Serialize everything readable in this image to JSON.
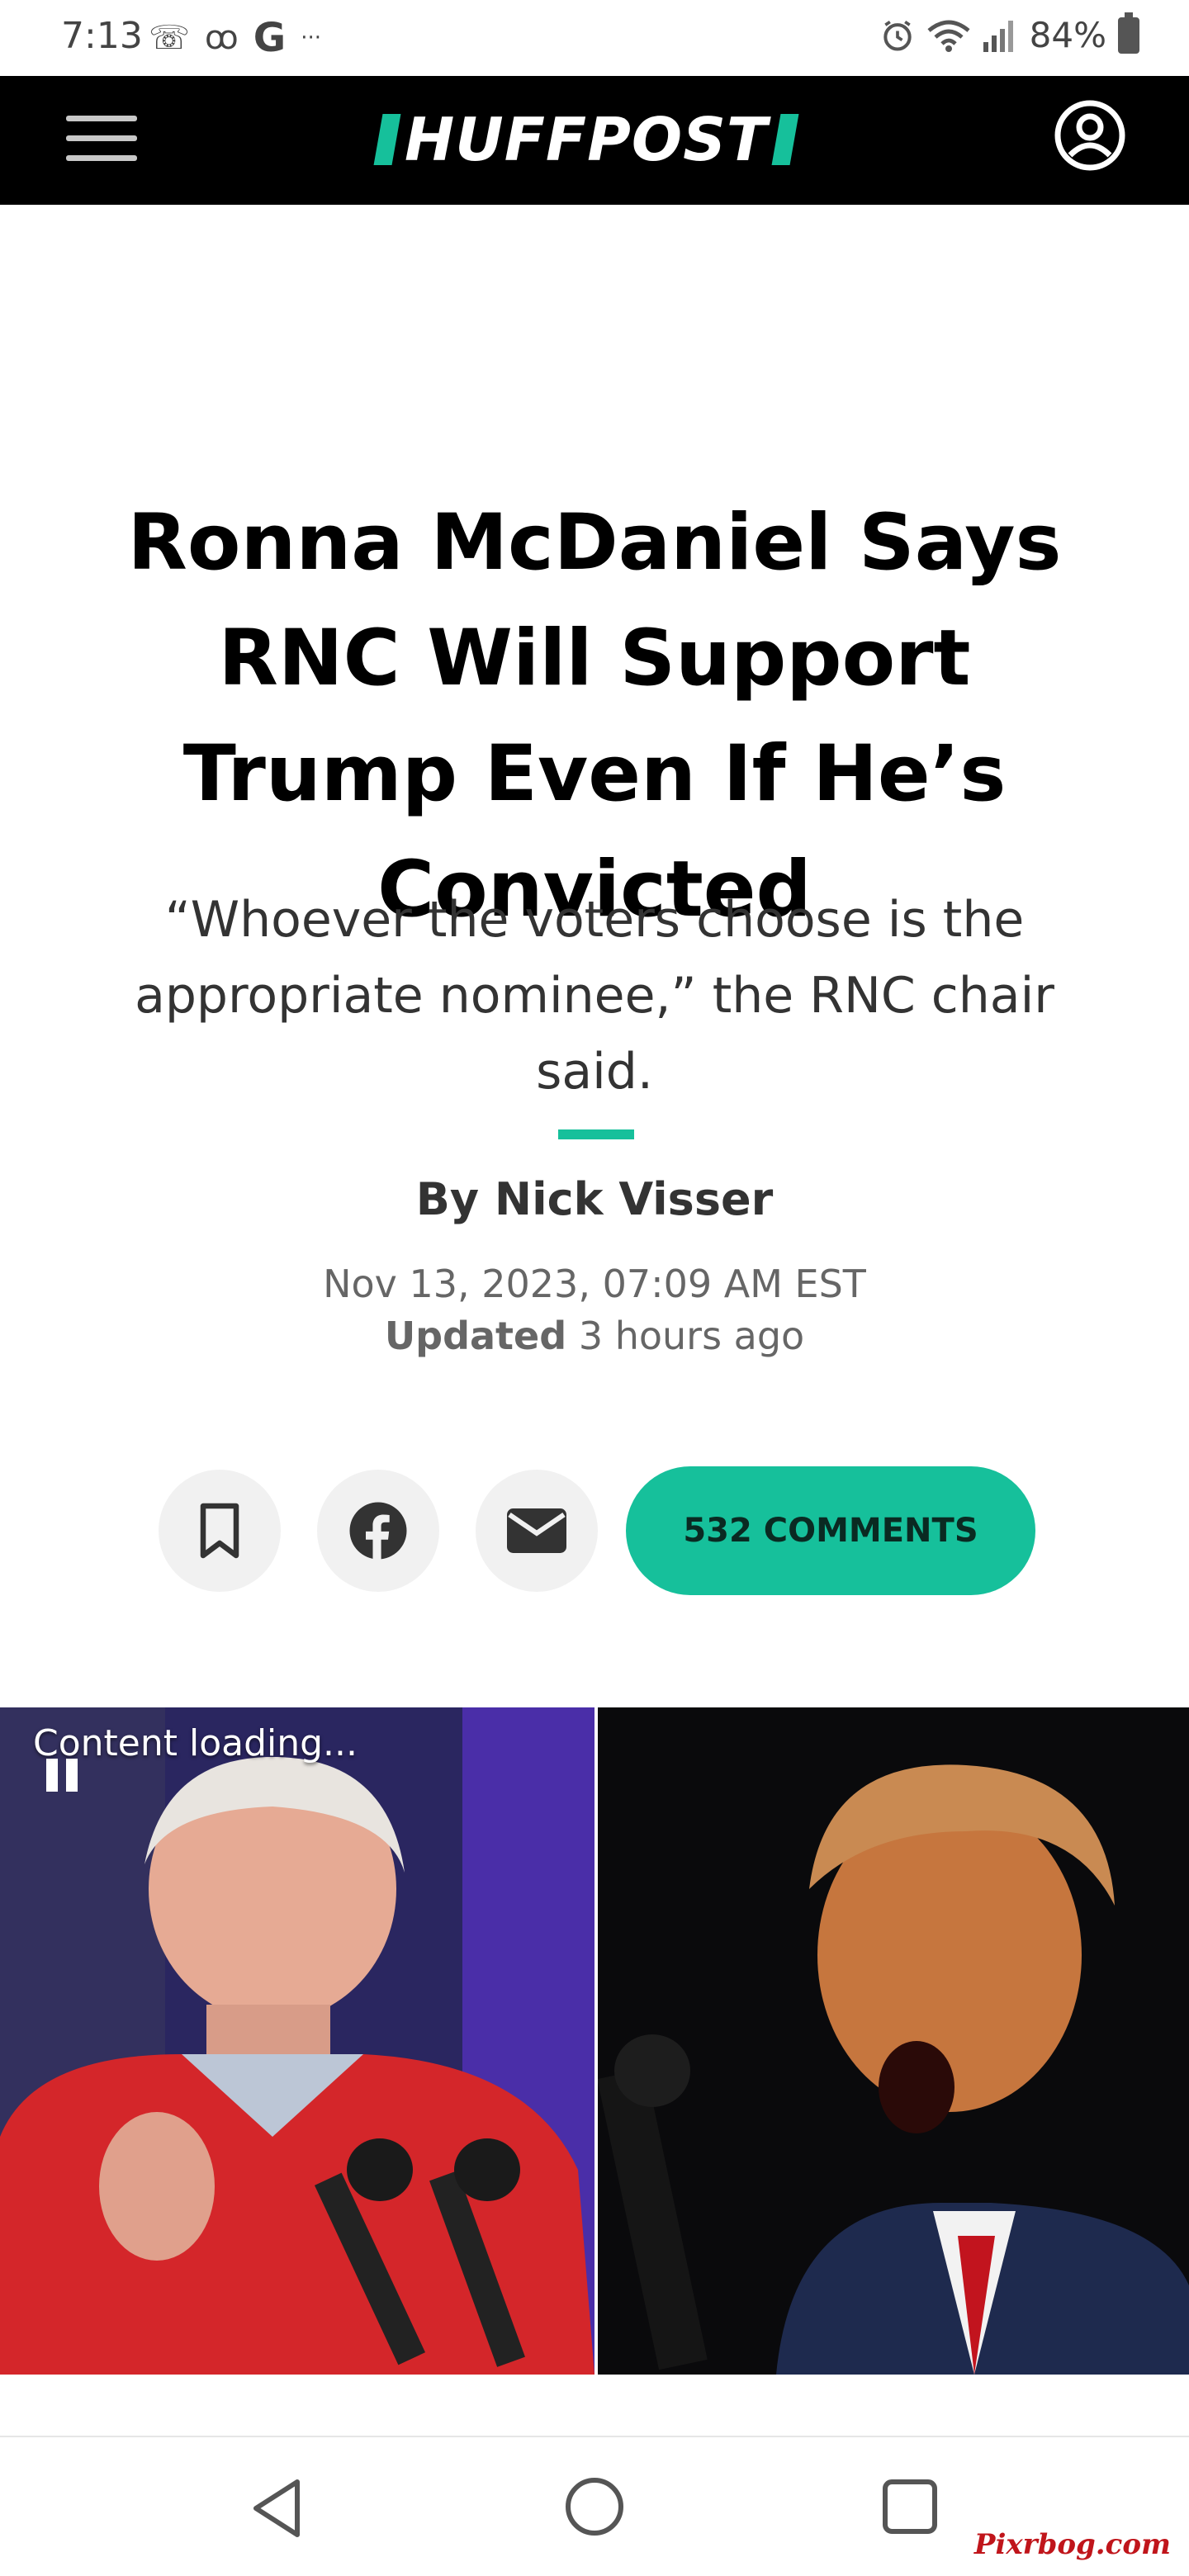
{
  "status_bar": {
    "time": "7:13",
    "left_icons": [
      "missed-call-icon",
      "voicemail-icon",
      "google-icon",
      "more-icon"
    ],
    "google_glyph": "G",
    "more_glyph": "···",
    "battery_percent": "84%",
    "right_icons": [
      "alarm-icon",
      "wifi-icon",
      "signal-icon",
      "battery-icon"
    ]
  },
  "header": {
    "logo": "HUFFPOST",
    "brand_color": "#16c09b",
    "menu_icon": "hamburger-menu-icon",
    "account_icon": "account-icon"
  },
  "article": {
    "headline": "Ronna McDaniel Says RNC Will Support Trump Even If He’s Convicted",
    "subhead": "“Whoever the voters choose is the appropriate nominee,” the RNC chair said.",
    "byline": "By Nick Visser",
    "published": "Nov 13, 2023, 07:09 AM EST",
    "updated_label": "Updated",
    "updated_value": "3 hours ago"
  },
  "share": {
    "icons": [
      "bookmark-icon",
      "facebook-icon",
      "email-icon"
    ],
    "comments_label": "532 COMMENTS"
  },
  "media": {
    "loading_label": "Content loading..."
  },
  "navbar": {
    "icons": [
      "back-icon",
      "home-icon",
      "recent-apps-icon"
    ]
  },
  "watermark": "Pixrbog.com"
}
